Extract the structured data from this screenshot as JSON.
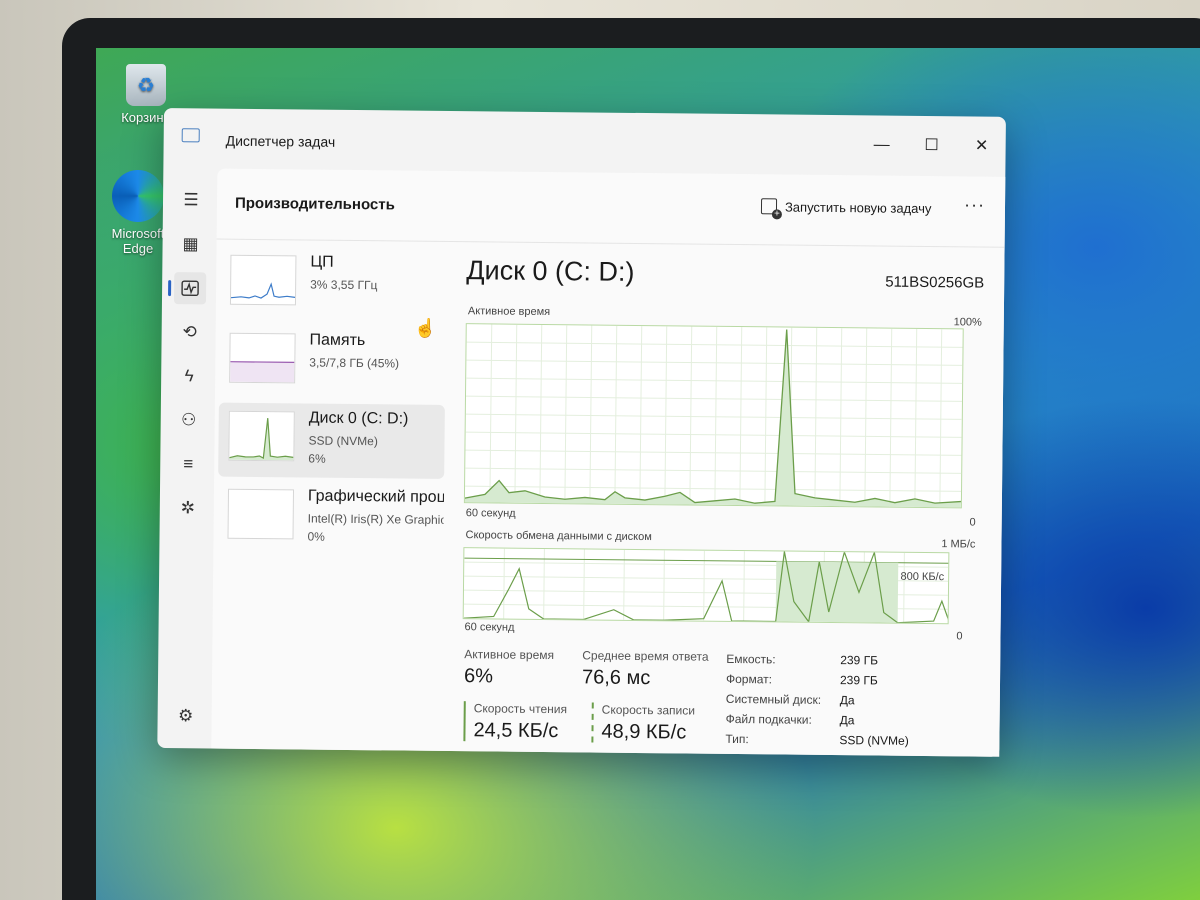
{
  "desktop": {
    "icons": [
      {
        "label": "Корзина"
      },
      {
        "label": "Microsoft Edge"
      }
    ]
  },
  "window": {
    "title": "Диспетчер задач",
    "controls": {
      "minimize": "—",
      "maximize": "☐",
      "close": "✕"
    }
  },
  "nav": {
    "icons": [
      "menu-icon",
      "processes-icon",
      "performance-icon",
      "app-history-icon",
      "startup-apps-icon",
      "users-icon",
      "details-icon",
      "services-icon",
      "settings-icon"
    ]
  },
  "header": {
    "title": "Производительность",
    "run_task": "Запустить новую задачу",
    "more": "···"
  },
  "devices": [
    {
      "name": "ЦП",
      "sub1": "3% 3,55 ГГц",
      "sub2": ""
    },
    {
      "name": "Память",
      "sub1": "3,5/7,8 ГБ (45%)",
      "sub2": ""
    },
    {
      "name": "Диск 0 (C: D:)",
      "sub1": "SSD (NVMe)",
      "sub2": "6%"
    },
    {
      "name": "Графический процессор",
      "sub1": "Intel(R) Iris(R) Xe Graphics",
      "sub2": "0%"
    }
  ],
  "detail": {
    "title": "Диск 0 (C: D:)",
    "model": "511BS0256GB",
    "graph1": {
      "label": "Активное время",
      "max": "100%",
      "time": "60 секунд",
      "min": "0"
    },
    "graph2": {
      "label": "Скорость обмена данными с диском",
      "max": "1 МБ/с",
      "mid": "800 КБ/с",
      "time": "60 секунд",
      "min": "0"
    }
  },
  "stats": {
    "active_time": {
      "label": "Активное время",
      "value": "6%"
    },
    "avg_response": {
      "label": "Среднее время ответа",
      "value": "76,6 мс"
    },
    "read_speed": {
      "label": "Скорость чтения",
      "value": "24,5 КБ/с"
    },
    "write_speed": {
      "label": "Скорость записи",
      "value": "48,9 КБ/с"
    }
  },
  "properties": [
    {
      "key": "Емкость:",
      "value": "239 ГБ"
    },
    {
      "key": "Формат:",
      "value": "239 ГБ"
    },
    {
      "key": "Системный диск:",
      "value": "Да"
    },
    {
      "key": "Файл подкачки:",
      "value": "Да"
    },
    {
      "key": "Тип:",
      "value": "SSD (NVMe)"
    }
  ],
  "colors": {
    "accent": "#2a63c4",
    "graph_line": "#6b9e4a",
    "graph_fill": "#d6ead0"
  }
}
